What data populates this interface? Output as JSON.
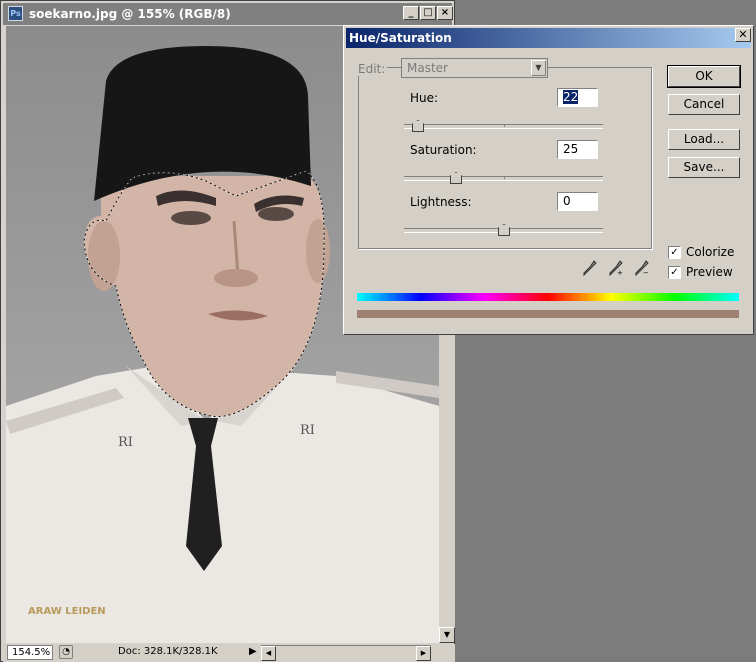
{
  "document_window": {
    "title": "soekarno.jpg @ 155% (RGB/8)",
    "status": {
      "zoom": "154.5%",
      "doc_info": "Doc: 328.1K/328.1K"
    },
    "watermark": "ARAW LEIDEN"
  },
  "dialog": {
    "title": "Hue/Saturation",
    "edit_label": "Edit:",
    "edit_value": "Master",
    "hue": {
      "label": "Hue:",
      "value": "22",
      "range": [
        -180,
        180
      ]
    },
    "saturation": {
      "label": "Saturation:",
      "value": "25",
      "range": [
        0,
        100
      ]
    },
    "lightness": {
      "label": "Lightness:",
      "value": "0",
      "range": [
        -100,
        100
      ]
    },
    "buttons": {
      "ok": "OK",
      "cancel": "Cancel",
      "load": "Load...",
      "save": "Save..."
    },
    "colorize": {
      "label": "Colorize",
      "checked": true
    },
    "preview": {
      "label": "Preview",
      "checked": true
    },
    "result_color": "#a08070"
  }
}
